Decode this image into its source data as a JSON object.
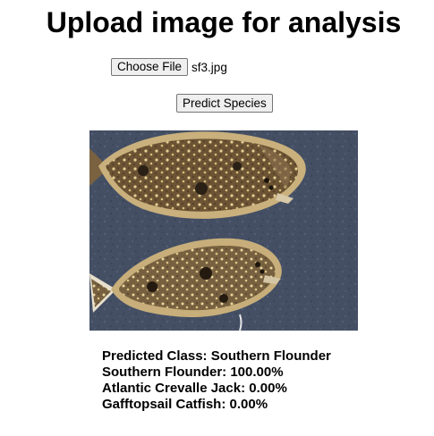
{
  "page": {
    "title": "Upload image for analysis"
  },
  "upload": {
    "choose_file_label": "Choose File",
    "selected_file": "sf3.jpg"
  },
  "predict": {
    "button_label": "Predict Species"
  },
  "image": {
    "subject": "two-flounder-photo"
  },
  "results": {
    "predicted_class": "Predicted Class: Southern Flounder",
    "scores": [
      "Southern Flounder: 100.00%",
      "Atlantic Crevalle Jack: 0.00%",
      "Gafftopsail Catfish: 0.00%"
    ]
  }
}
